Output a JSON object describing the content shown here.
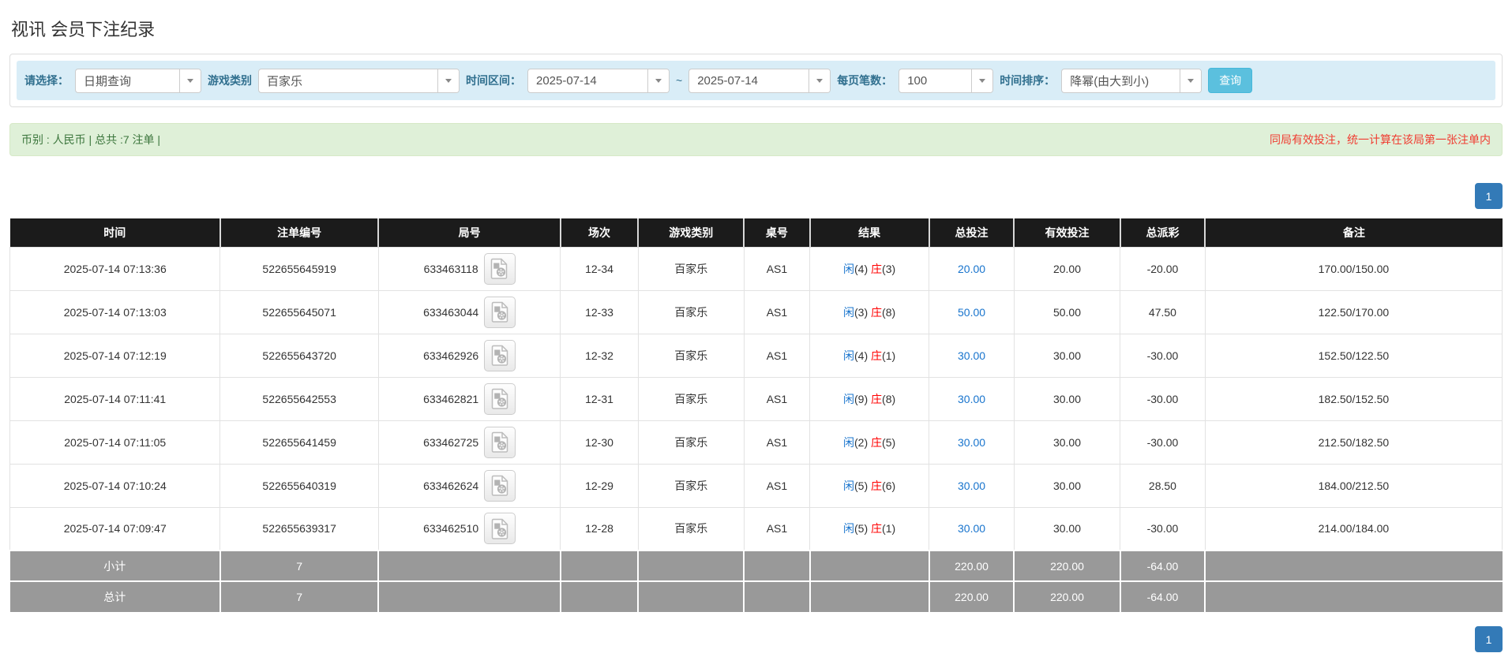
{
  "page": {
    "title": "视讯 会员下注纪录"
  },
  "filters": {
    "select_label": "请选择：",
    "select_value": "日期查询",
    "game_type_label": "游戏类别",
    "game_type_value": "百家乐",
    "date_range_label": "时间区间：",
    "date_from": "2025-07-14",
    "date_separator": "~",
    "date_to": "2025-07-14",
    "page_size_label": "每页笔数：",
    "page_size_value": "100",
    "sort_label": "时间排序：",
    "sort_value": "降幂(由大到小)",
    "search_button": "查询"
  },
  "info_bar": {
    "summary": "币别 : 人民币 | 总共 :7 注单 |",
    "notice": "同局有效投注，统一计算在该局第一张注单内"
  },
  "pagination": {
    "page": "1"
  },
  "icons": {
    "round_video_icon": "video-record-icon",
    "combo_arrow": "chevron-down-icon"
  },
  "colors": {
    "header_bg": "#1b1b1b",
    "footer_bg": "#999999",
    "accent_blue": "#1874cd",
    "negative_red": "#ff0000",
    "info_green_bg": "#dff0d8",
    "filter_blue_bg": "#d9edf7",
    "search_btn_bg": "#5bc0de",
    "pager_btn_bg": "#337ab7"
  },
  "table": {
    "headers": [
      "时间",
      "注单编号",
      "局号",
      "场次",
      "游戏类别",
      "桌号",
      "结果",
      "总投注",
      "有效投注",
      "总派彩",
      "备注"
    ],
    "rows": [
      {
        "time": "2025-07-14 07:13:36",
        "bet_id": "522655645919",
        "round_id": "633463118",
        "session": "12-34",
        "game": "百家乐",
        "table_no": "AS1",
        "result": {
          "player_label": "闲",
          "player_score": 4,
          "banker_label": "庄",
          "banker_score": 3
        },
        "total_bet": "20.00",
        "valid_bet": "20.00",
        "payout": "-20.00",
        "remark": "170.00/150.00"
      },
      {
        "time": "2025-07-14 07:13:03",
        "bet_id": "522655645071",
        "round_id": "633463044",
        "session": "12-33",
        "game": "百家乐",
        "table_no": "AS1",
        "result": {
          "player_label": "闲",
          "player_score": 3,
          "banker_label": "庄",
          "banker_score": 8
        },
        "total_bet": "50.00",
        "valid_bet": "50.00",
        "payout": "47.50",
        "remark": "122.50/170.00"
      },
      {
        "time": "2025-07-14 07:12:19",
        "bet_id": "522655643720",
        "round_id": "633462926",
        "session": "12-32",
        "game": "百家乐",
        "table_no": "AS1",
        "result": {
          "player_label": "闲",
          "player_score": 4,
          "banker_label": "庄",
          "banker_score": 1
        },
        "total_bet": "30.00",
        "valid_bet": "30.00",
        "payout": "-30.00",
        "remark": "152.50/122.50"
      },
      {
        "time": "2025-07-14 07:11:41",
        "bet_id": "522655642553",
        "round_id": "633462821",
        "session": "12-31",
        "game": "百家乐",
        "table_no": "AS1",
        "result": {
          "player_label": "闲",
          "player_score": 9,
          "banker_label": "庄",
          "banker_score": 8
        },
        "total_bet": "30.00",
        "valid_bet": "30.00",
        "payout": "-30.00",
        "remark": "182.50/152.50"
      },
      {
        "time": "2025-07-14 07:11:05",
        "bet_id": "522655641459",
        "round_id": "633462725",
        "session": "12-30",
        "game": "百家乐",
        "table_no": "AS1",
        "result": {
          "player_label": "闲",
          "player_score": 2,
          "banker_label": "庄",
          "banker_score": 5
        },
        "total_bet": "30.00",
        "valid_bet": "30.00",
        "payout": "-30.00",
        "remark": "212.50/182.50"
      },
      {
        "time": "2025-07-14 07:10:24",
        "bet_id": "522655640319",
        "round_id": "633462624",
        "session": "12-29",
        "game": "百家乐",
        "table_no": "AS1",
        "result": {
          "player_label": "闲",
          "player_score": 5,
          "banker_label": "庄",
          "banker_score": 6
        },
        "total_bet": "30.00",
        "valid_bet": "30.00",
        "payout": "28.50",
        "remark": "184.00/212.50"
      },
      {
        "time": "2025-07-14 07:09:47",
        "bet_id": "522655639317",
        "round_id": "633462510",
        "session": "12-28",
        "game": "百家乐",
        "table_no": "AS1",
        "result": {
          "player_label": "闲",
          "player_score": 5,
          "banker_label": "庄",
          "banker_score": 1
        },
        "total_bet": "30.00",
        "valid_bet": "30.00",
        "payout": "-30.00",
        "remark": "214.00/184.00"
      }
    ],
    "subtotal": {
      "label": "小计",
      "count": "7",
      "total_bet": "220.00",
      "valid_bet": "220.00",
      "payout": "-64.00",
      "remark": ""
    },
    "total": {
      "label": "总计",
      "count": "7",
      "total_bet": "220.00",
      "valid_bet": "220.00",
      "payout": "-64.00",
      "remark": ""
    }
  }
}
